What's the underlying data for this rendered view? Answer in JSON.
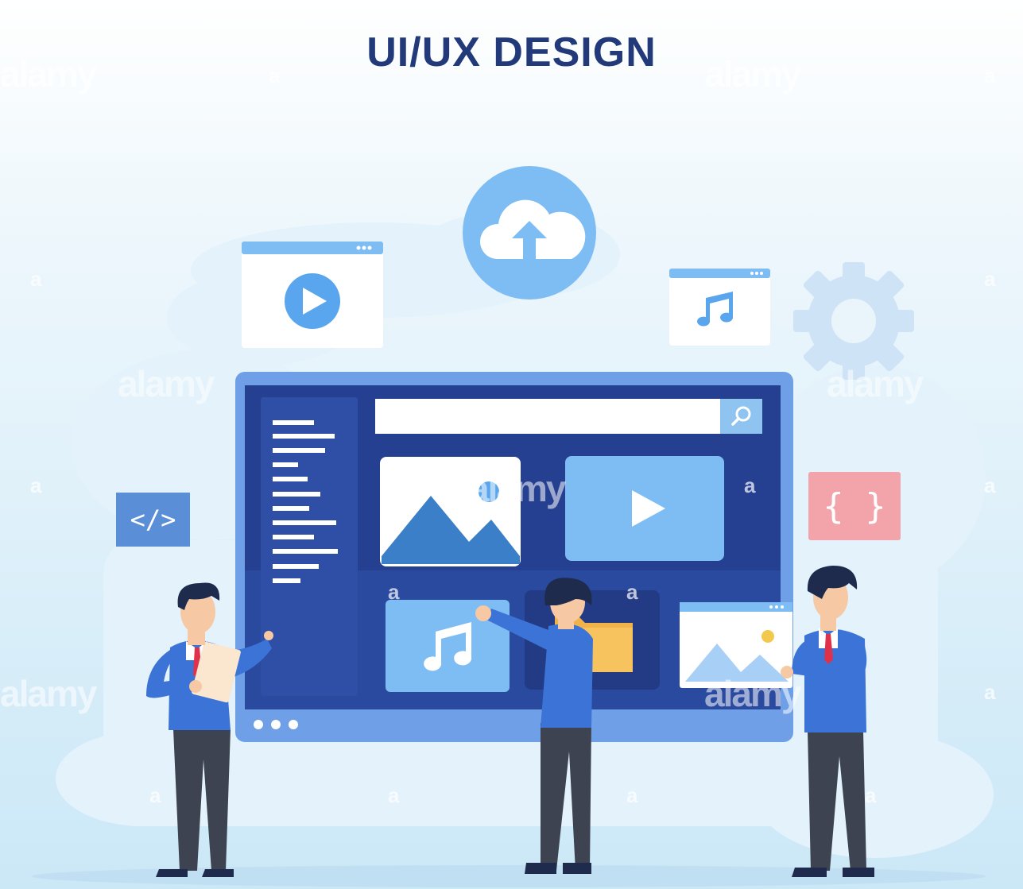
{
  "title": "UI/UX DESIGN",
  "code_tag": "</>",
  "brace_tag": "{ }",
  "watermark": {
    "brand": "alamy",
    "mark": "a"
  },
  "colors": {
    "navy": "#233a7a",
    "screen_frame": "#6f9fe6",
    "screen_inner": "#253f91",
    "light_blue": "#7dbdf4",
    "card_white": "#ffffff",
    "folder_orange": "#f2b24a",
    "tag_blue": "#5a8fd8",
    "tag_pink": "#f3a4ab",
    "suit_blue": "#3b74d6",
    "pants_dark": "#3d4350",
    "skin": "#f6c9a4",
    "hair": "#1f2b4d"
  },
  "icons": [
    "cloud-upload-icon",
    "video-window-icon",
    "music-window-icon",
    "gear-icon",
    "search-icon",
    "image-icon",
    "play-icon",
    "music-note-icon",
    "folder-icon",
    "code-tag-icon",
    "curly-braces-icon"
  ]
}
